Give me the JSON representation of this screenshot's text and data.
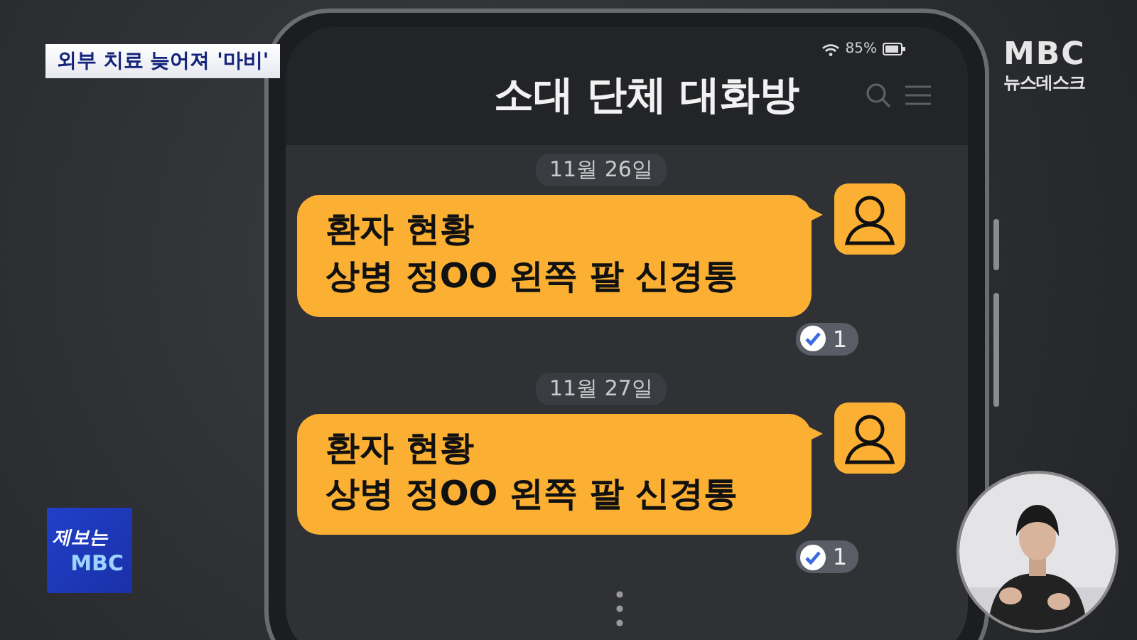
{
  "caption": "외부 치료 늦어져 '마비'",
  "channel_logo": {
    "brand": "MBC",
    "program": "뉴스데스크"
  },
  "tip_badge": {
    "line_1": "제보는",
    "line_2": "MBC"
  },
  "phone": {
    "battery": "85%",
    "title": "소대 단체 대화방",
    "messages": [
      {
        "date": "11월 26일",
        "lines": [
          "환자 현황",
          "상병 정OO 왼쪽 팔 신경통"
        ],
        "read_count": "1"
      },
      {
        "date": "11월 27일",
        "lines": [
          "환자 현황",
          "상병 정OO 왼쪽 팔 신경통"
        ],
        "read_count": "1"
      }
    ]
  }
}
